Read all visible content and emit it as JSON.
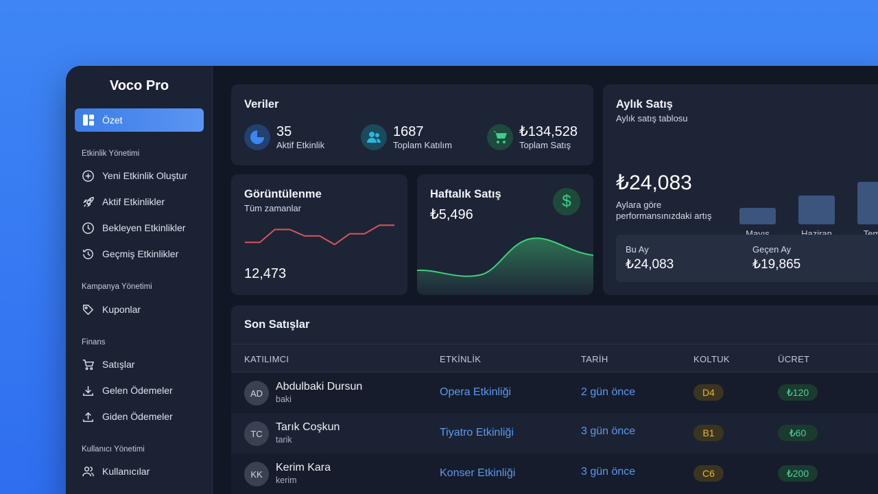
{
  "brand": "Voco Pro",
  "nav": {
    "active": "Özet",
    "sections": [
      {
        "title": "Etkinlik Yönetimi",
        "items": [
          "Yeni Etkinlik Oluştur",
          "Aktif Etkinlikler",
          "Bekleyen Etkinlikler",
          "Geçmiş Etkinlikler"
        ]
      },
      {
        "title": "Kampanya Yönetimi",
        "items": [
          "Kuponlar"
        ]
      },
      {
        "title": "Finans",
        "items": [
          "Satışlar",
          "Gelen Ödemeler",
          "Giden Ödemeler"
        ]
      },
      {
        "title": "Kullanıcı Yönetimi",
        "items": [
          "Kullanıcılar"
        ]
      }
    ]
  },
  "veriler": {
    "title": "Veriler",
    "stats": [
      {
        "value": "35",
        "label": "Aktif Etkinlik",
        "icon": "pie-chart-icon",
        "color": "#2f6fd6"
      },
      {
        "value": "1687",
        "label": "Toplam Katılım",
        "icon": "users-icon",
        "color": "#1f9bc2"
      },
      {
        "value": "₺134,528",
        "label": "Toplam Satış",
        "icon": "cart-icon",
        "color": "#2eb27a"
      }
    ]
  },
  "goruntulenme": {
    "title": "Görüntülenme",
    "subtitle": "Tüm zamanlar",
    "value": "12,473",
    "sparkline": [
      3,
      3,
      6,
      6,
      4.5,
      4.5,
      2.5,
      5,
      5,
      7,
      7
    ]
  },
  "haftalik": {
    "title": "Haftalık Satış",
    "value": "₺5,496",
    "icon": "dollar-icon"
  },
  "aylik": {
    "title": "Aylık Satış",
    "subtitle": "Aylık satış tablosu",
    "value": "₺24,083",
    "caption_line1": "Aylara göre",
    "caption_line2": "performansınızdaki artış",
    "bars": [
      {
        "label": "Mayıs",
        "value": 30
      },
      {
        "label": "Haziran",
        "value": 52
      },
      {
        "label": "Temm",
        "value": 78
      }
    ],
    "compare": {
      "current_label": "Bu Ay",
      "current_value": "₺24,083",
      "previous_label": "Geçen Ay",
      "previous_value": "₺19,865"
    }
  },
  "son_satislar": {
    "title": "Son Satışlar",
    "columns": [
      "KATILIMCI",
      "ETKİNLİK",
      "TARİH",
      "KOLTUK",
      "ÜCRET"
    ],
    "rows": [
      {
        "initials": "AD",
        "name": "Abdulbaki Dursun",
        "user": "baki",
        "event": "Opera Etkinliği",
        "date": "2 gün önce",
        "seat": "D4",
        "price": "₺120"
      },
      {
        "initials": "TC",
        "name": "Tarık Coşkun",
        "user": "tarik",
        "event": "Tiyatro Etkinliği",
        "date": "3 gün önce",
        "seat": "B1",
        "price": "₺60"
      },
      {
        "initials": "KK",
        "name": "Kerim Kara",
        "user": "kerim",
        "event": "Konser Etkinliği",
        "date": "3 gün önce",
        "seat": "C6",
        "price": "₺200"
      }
    ]
  }
}
